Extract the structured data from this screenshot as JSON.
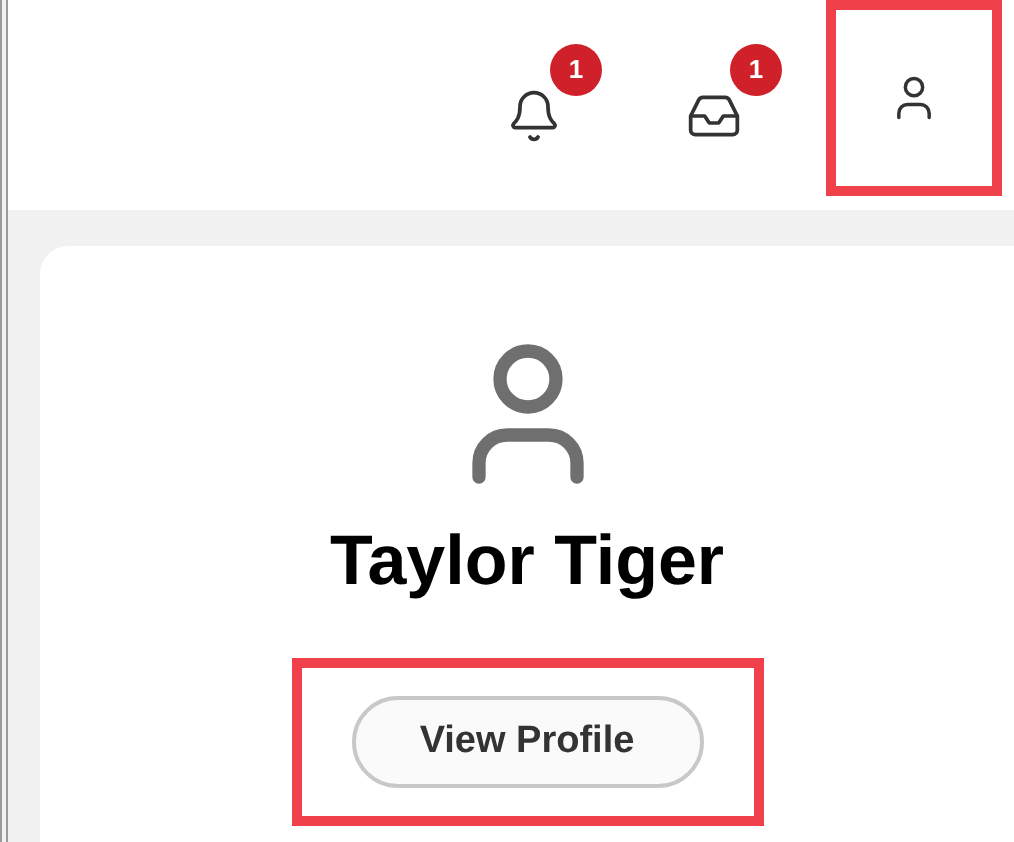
{
  "header": {
    "notifications": {
      "count": "1"
    },
    "inbox": {
      "count": "1"
    },
    "account": {
      "highlighted": true
    }
  },
  "profile_card": {
    "name": "Taylor Tiger",
    "button": {
      "label": "View Profile",
      "highlighted": true
    }
  }
}
